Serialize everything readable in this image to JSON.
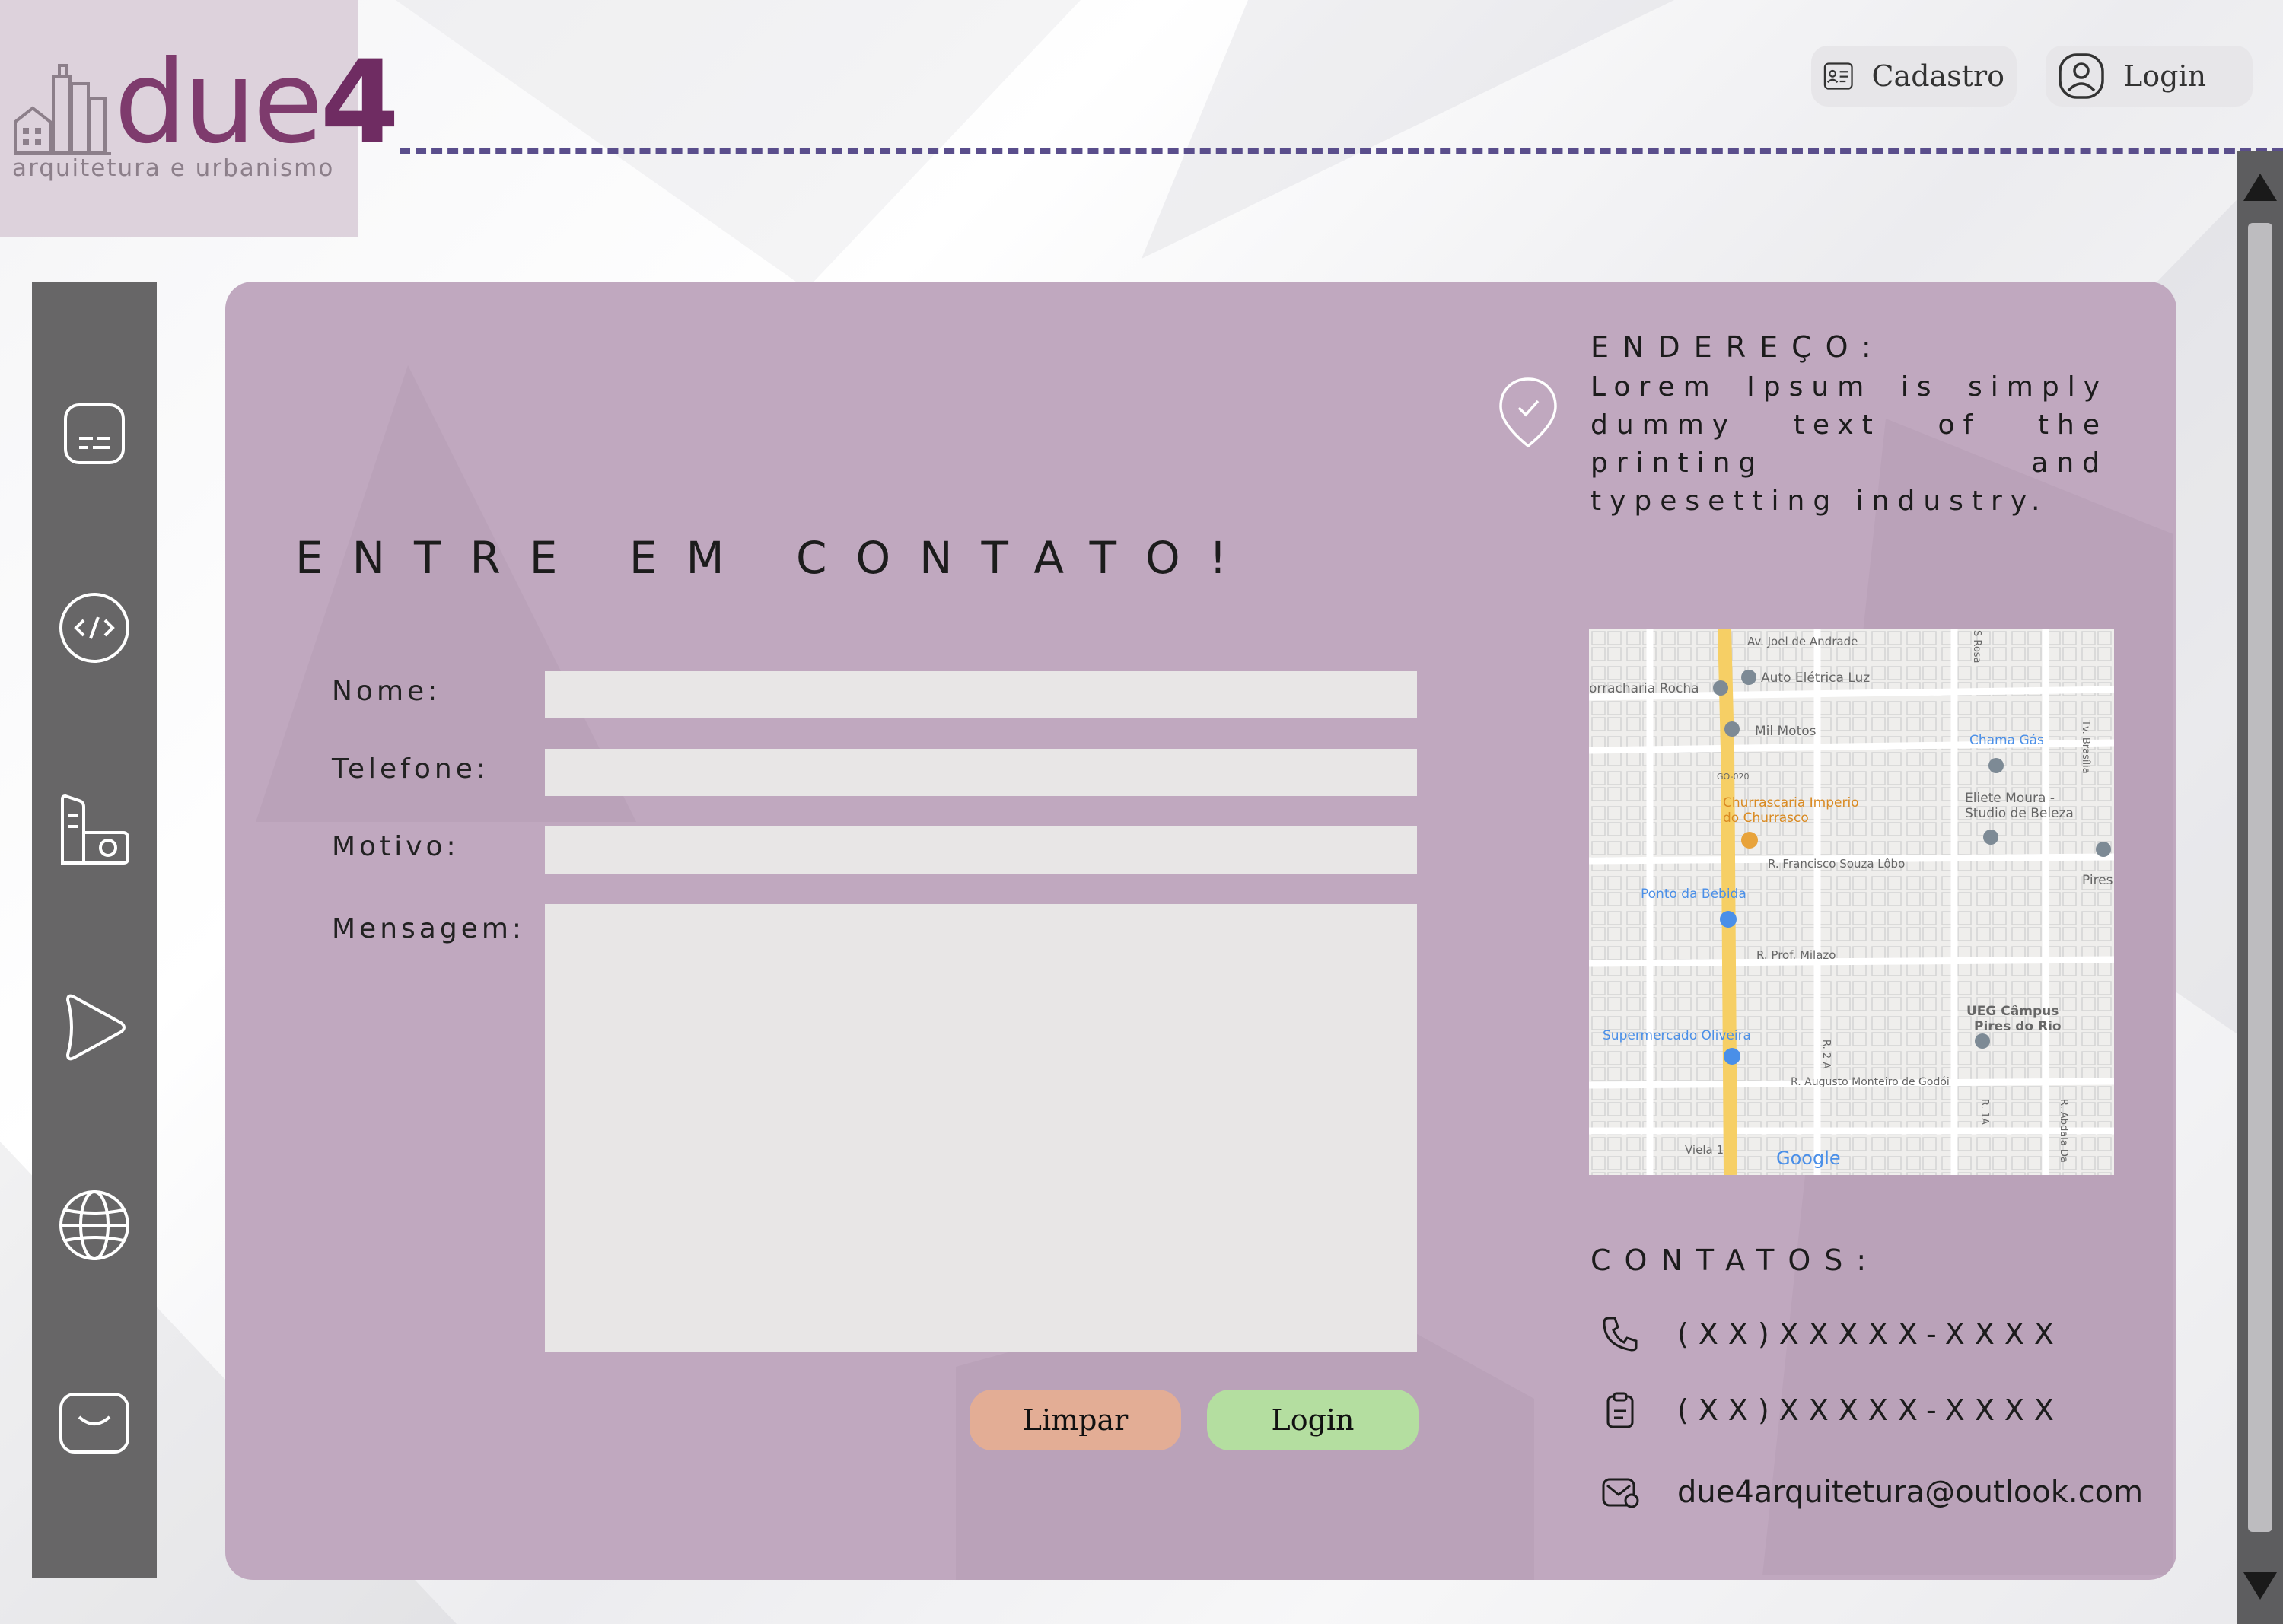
{
  "logo": {
    "word": "due",
    "digit": "4",
    "tagline": "arquitetura e urbanismo"
  },
  "header": {
    "cadastro_label": "Cadastro",
    "login_label": "Login"
  },
  "sidebar": {
    "items": [
      {
        "icon": "subtitles-icon"
      },
      {
        "icon": "code-icon"
      },
      {
        "icon": "buildings-icon"
      },
      {
        "icon": "play-icon"
      },
      {
        "icon": "globe-icon"
      },
      {
        "icon": "inbox-icon"
      }
    ]
  },
  "contact_form": {
    "title": "ENTRE EM CONTATO!",
    "fields": {
      "nome_label": "Nome:",
      "telefone_label": "Telefone:",
      "motivo_label": "Motivo:",
      "mensagem_label": "Mensagem:"
    },
    "values": {
      "nome": "",
      "telefone": "",
      "motivo": "",
      "mensagem": ""
    },
    "buttons": {
      "clear": "Limpar",
      "submit": "Login"
    }
  },
  "info": {
    "address_heading": "ENDEREÇO:",
    "address_text": "Lorem Ipsum is simply dummy text of the printing and typesetting industry.",
    "contacts_heading": "CONTATOS:",
    "phone": "(XX)XXXXX-XXXX",
    "whatsapp": "(XX)XXXXX-XXXX",
    "email": "due4arquitetura@outlook.com"
  },
  "map": {
    "labels": [
      "Av. Joel de Andrade",
      "Auto Elétrica Luz",
      "orracharia Rocha",
      "Mil Motos",
      "GO-020",
      "Chama Gás",
      "Tv. Brasília",
      "Churrascaria Imperio do Churrasco",
      "Eliete Moura - Studio de Beleza",
      "R. Francisco Souza Lôbo",
      "Pires",
      "Ponto da Bebida",
      "R. Prof. Milazo",
      "UEG Câmpus Pires do Rio",
      "Supermercado Oliveira",
      "R. 2-A",
      "R. Augusto Monteiro de Godói",
      "R. 1A",
      "R. Abdala Da",
      "Viela 1",
      "S Rosa"
    ],
    "brand": "Google",
    "colors": {
      "main_road": "#f6cf65",
      "blue_pin": "#4a8fe8",
      "orange_pin": "#e8a33b",
      "grey_pin": "#7d8a95"
    }
  },
  "colors": {
    "card": "#c0a8bf",
    "brand": "#7e3b6d",
    "sidebar": "#676667",
    "clear_button": "#e3ad95",
    "submit_button": "#b4dea0"
  }
}
